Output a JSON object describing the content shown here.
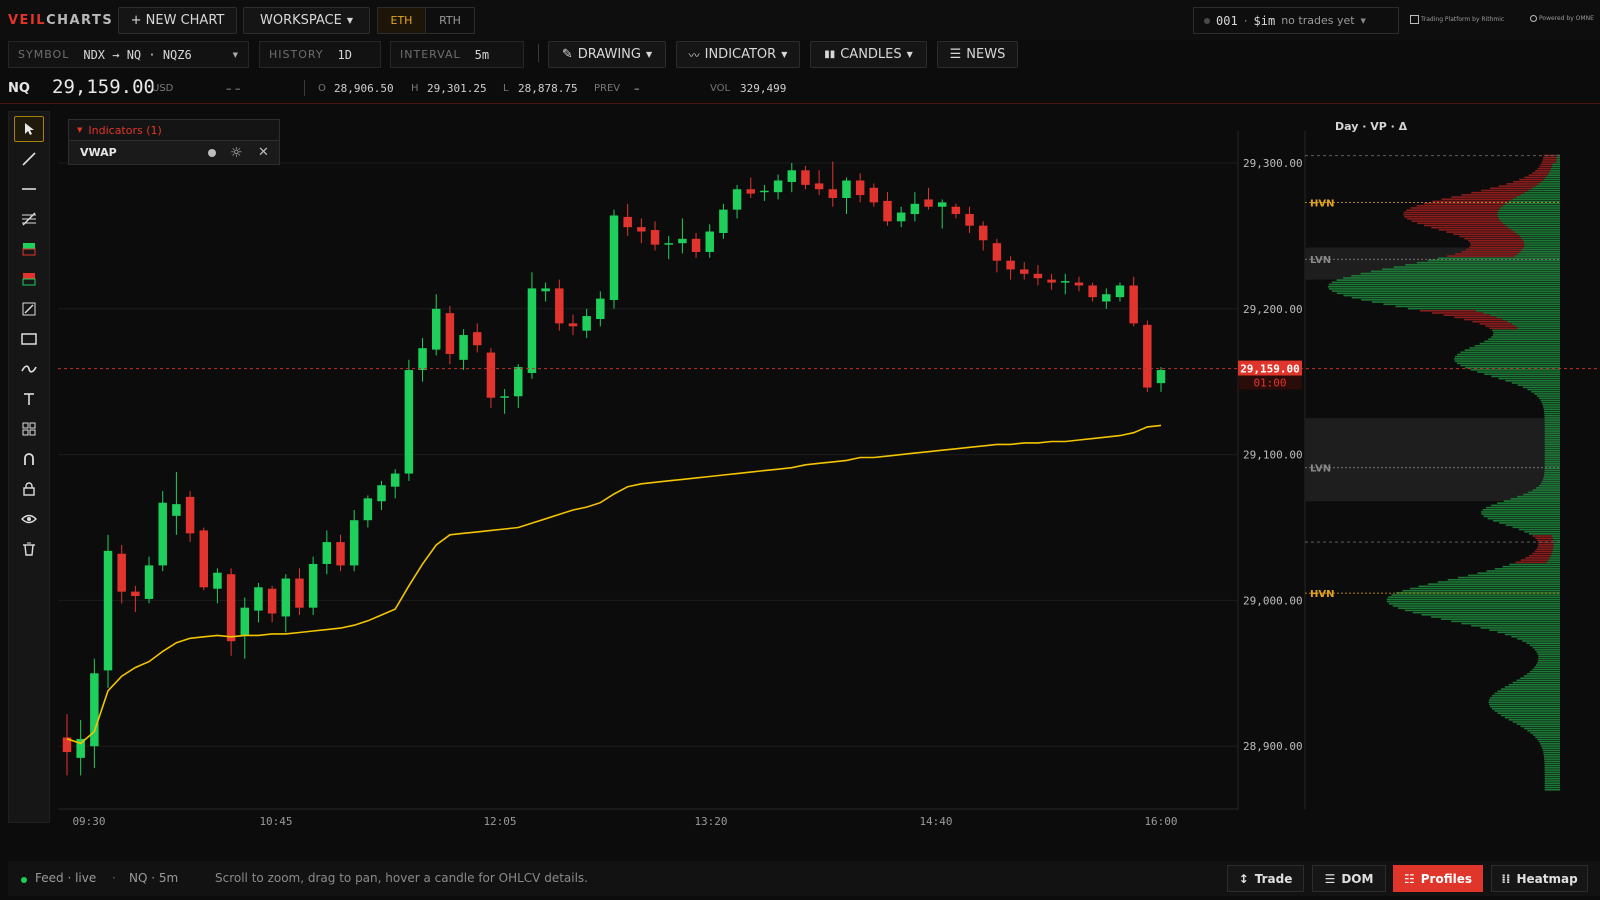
{
  "app": {
    "logo_part1": "VEIL",
    "logo_part2": "CHARTS"
  },
  "topbar": {
    "new_chart": "+ NEW CHART",
    "workspace": "WORKSPACE",
    "session_eth": "ETH",
    "session_rth": "RTH",
    "account_id": "001",
    "account_type": "$im",
    "account_status": "no trades yet",
    "brand_rithmic": "Trading Platform by Rithmic",
    "brand_omne": "Powered by OMNE"
  },
  "toolbar": {
    "symbol_label": "SYMBOL",
    "symbol_value": "NDX → NQ · NQZ6",
    "history_label": "HISTORY",
    "history_value": "1D",
    "interval_label": "INTERVAL",
    "interval_value": "5m",
    "drawing": "DRAWING",
    "indicator": "INDICATOR",
    "candles": "CANDLES",
    "news": "NEWS"
  },
  "quote": {
    "symbol": "NQ",
    "price": "29,159.00",
    "currency": "USD",
    "change": "– –",
    "open_label": "O",
    "open": "28,906.50",
    "high_label": "H",
    "high": "29,301.25",
    "low_label": "L",
    "low": "28,878.75",
    "prev_label": "PREV",
    "prev": "–",
    "vol_label": "VOL",
    "vol": "329,499"
  },
  "indicators_panel": {
    "header": "Indicators (1)",
    "items": [
      {
        "label": "VWAP"
      }
    ]
  },
  "volume_profile": {
    "title": "Day · VP · Δ",
    "hvn_label": "HVN",
    "lvn_label": "LVN"
  },
  "price_axis": {
    "ticks": [
      {
        "label": "29,300.00",
        "value": 29300
      },
      {
        "label": "29,200.00",
        "value": 29200
      },
      {
        "label": "29,100.00",
        "value": 29100
      },
      {
        "label": "29,000.00",
        "value": 29000
      },
      {
        "label": "28,900.00",
        "value": 28900
      }
    ],
    "current_price_label": "29,159.00",
    "countdown": "01:00"
  },
  "time_axis": {
    "ticks": [
      "09:30",
      "10:45",
      "12:05",
      "13:20",
      "14:40",
      "16:00"
    ]
  },
  "colors": {
    "up": "#1fcf5c",
    "down": "#e2342e",
    "vwap": "#f3c400",
    "accent": "#e0352b",
    "gold": "#e4a41d",
    "vp_up": "#1c7a37",
    "vp_down": "#8c1d1d"
  },
  "chart_data": {
    "type": "candlestick",
    "ylim": [
      28850,
      29330
    ],
    "candles": [
      {
        "o": 28906,
        "h": 28922,
        "l": 28880,
        "c": 28896
      },
      {
        "o": 28892,
        "h": 28918,
        "l": 28880,
        "c": 28905
      },
      {
        "o": 28900,
        "h": 28960,
        "l": 28885,
        "c": 28950
      },
      {
        "o": 28952,
        "h": 29045,
        "l": 28940,
        "c": 29034
      },
      {
        "o": 29032,
        "h": 29038,
        "l": 28998,
        "c": 29006
      },
      {
        "o": 29006,
        "h": 29010,
        "l": 28992,
        "c": 29003
      },
      {
        "o": 29001,
        "h": 29030,
        "l": 28998,
        "c": 29024
      },
      {
        "o": 29024,
        "h": 29075,
        "l": 29020,
        "c": 29067
      },
      {
        "o": 29058,
        "h": 29088,
        "l": 29045,
        "c": 29066
      },
      {
        "o": 29071,
        "h": 29075,
        "l": 29040,
        "c": 29046
      },
      {
        "o": 29048,
        "h": 29050,
        "l": 29007,
        "c": 29009
      },
      {
        "o": 29008,
        "h": 29022,
        "l": 28998,
        "c": 29019
      },
      {
        "o": 29018,
        "h": 29022,
        "l": 28962,
        "c": 28972
      },
      {
        "o": 28976,
        "h": 29002,
        "l": 28960,
        "c": 28995
      },
      {
        "o": 28993,
        "h": 29012,
        "l": 28985,
        "c": 29009
      },
      {
        "o": 29008,
        "h": 29010,
        "l": 28985,
        "c": 28991
      },
      {
        "o": 28989,
        "h": 29018,
        "l": 28978,
        "c": 29015
      },
      {
        "o": 29015,
        "h": 29022,
        "l": 28990,
        "c": 28995
      },
      {
        "o": 28995,
        "h": 29030,
        "l": 28990,
        "c": 29025
      },
      {
        "o": 29025,
        "h": 29048,
        "l": 29018,
        "c": 29040
      },
      {
        "o": 29040,
        "h": 29045,
        "l": 29020,
        "c": 29024
      },
      {
        "o": 29024,
        "h": 29062,
        "l": 29020,
        "c": 29055
      },
      {
        "o": 29055,
        "h": 29072,
        "l": 29050,
        "c": 29070
      },
      {
        "o": 29068,
        "h": 29082,
        "l": 29062,
        "c": 29079
      },
      {
        "o": 29078,
        "h": 29090,
        "l": 29070,
        "c": 29087
      },
      {
        "o": 29087,
        "h": 29165,
        "l": 29082,
        "c": 29158
      },
      {
        "o": 29158,
        "h": 29180,
        "l": 29150,
        "c": 29173
      },
      {
        "o": 29172,
        "h": 29210,
        "l": 29168,
        "c": 29200
      },
      {
        "o": 29197,
        "h": 29202,
        "l": 29162,
        "c": 29169
      },
      {
        "o": 29165,
        "h": 29186,
        "l": 29158,
        "c": 29182
      },
      {
        "o": 29184,
        "h": 29190,
        "l": 29170,
        "c": 29175
      },
      {
        "o": 29170,
        "h": 29173,
        "l": 29132,
        "c": 29139
      },
      {
        "o": 29139,
        "h": 29145,
        "l": 29128,
        "c": 29140
      },
      {
        "o": 29140,
        "h": 29162,
        "l": 29132,
        "c": 29160
      },
      {
        "o": 29156,
        "h": 29225,
        "l": 29152,
        "c": 29214
      },
      {
        "o": 29212,
        "h": 29218,
        "l": 29205,
        "c": 29214
      },
      {
        "o": 29214,
        "h": 29220,
        "l": 29185,
        "c": 29190
      },
      {
        "o": 29190,
        "h": 29196,
        "l": 29182,
        "c": 29188
      },
      {
        "o": 29185,
        "h": 29200,
        "l": 29180,
        "c": 29195
      },
      {
        "o": 29193,
        "h": 29212,
        "l": 29188,
        "c": 29207
      },
      {
        "o": 29206,
        "h": 29268,
        "l": 29200,
        "c": 29264
      },
      {
        "o": 29263,
        "h": 29272,
        "l": 29250,
        "c": 29256
      },
      {
        "o": 29256,
        "h": 29262,
        "l": 29245,
        "c": 29253
      },
      {
        "o": 29254,
        "h": 29260,
        "l": 29240,
        "c": 29244
      },
      {
        "o": 29244,
        "h": 29250,
        "l": 29234,
        "c": 29245
      },
      {
        "o": 29245,
        "h": 29262,
        "l": 29238,
        "c": 29248
      },
      {
        "o": 29248,
        "h": 29252,
        "l": 29235,
        "c": 29239
      },
      {
        "o": 29239,
        "h": 29258,
        "l": 29235,
        "c": 29253
      },
      {
        "o": 29252,
        "h": 29272,
        "l": 29248,
        "c": 29268
      },
      {
        "o": 29268,
        "h": 29285,
        "l": 29262,
        "c": 29282
      },
      {
        "o": 29282,
        "h": 29290,
        "l": 29276,
        "c": 29279
      },
      {
        "o": 29280,
        "h": 29285,
        "l": 29274,
        "c": 29281
      },
      {
        "o": 29280,
        "h": 29292,
        "l": 29275,
        "c": 29288
      },
      {
        "o": 29287,
        "h": 29300,
        "l": 29280,
        "c": 29295
      },
      {
        "o": 29295,
        "h": 29298,
        "l": 29282,
        "c": 29285
      },
      {
        "o": 29286,
        "h": 29295,
        "l": 29278,
        "c": 29282
      },
      {
        "o": 29282,
        "h": 29301,
        "l": 29270,
        "c": 29276
      },
      {
        "o": 29276,
        "h": 29290,
        "l": 29265,
        "c": 29288
      },
      {
        "o": 29288,
        "h": 29293,
        "l": 29273,
        "c": 29278
      },
      {
        "o": 29283,
        "h": 29286,
        "l": 29270,
        "c": 29273
      },
      {
        "o": 29274,
        "h": 29280,
        "l": 29257,
        "c": 29260
      },
      {
        "o": 29260,
        "h": 29270,
        "l": 29256,
        "c": 29266
      },
      {
        "o": 29265,
        "h": 29280,
        "l": 29260,
        "c": 29272
      },
      {
        "o": 29275,
        "h": 29283,
        "l": 29268,
        "c": 29270
      },
      {
        "o": 29270,
        "h": 29275,
        "l": 29255,
        "c": 29273
      },
      {
        "o": 29270,
        "h": 29272,
        "l": 29262,
        "c": 29265
      },
      {
        "o": 29265,
        "h": 29270,
        "l": 29252,
        "c": 29257
      },
      {
        "o": 29257,
        "h": 29260,
        "l": 29240,
        "c": 29247
      },
      {
        "o": 29245,
        "h": 29248,
        "l": 29225,
        "c": 29233
      },
      {
        "o": 29233,
        "h": 29236,
        "l": 29220,
        "c": 29227
      },
      {
        "o": 29227,
        "h": 29232,
        "l": 29220,
        "c": 29224
      },
      {
        "o": 29224,
        "h": 29230,
        "l": 29216,
        "c": 29221
      },
      {
        "o": 29220,
        "h": 29224,
        "l": 29213,
        "c": 29218
      },
      {
        "o": 29218,
        "h": 29224,
        "l": 29210,
        "c": 29219
      },
      {
        "o": 29218,
        "h": 29222,
        "l": 29212,
        "c": 29216
      },
      {
        "o": 29216,
        "h": 29218,
        "l": 29205,
        "c": 29208
      },
      {
        "o": 29205,
        "h": 29214,
        "l": 29200,
        "c": 29210
      },
      {
        "o": 29208,
        "h": 29218,
        "l": 29205,
        "c": 29216
      },
      {
        "o": 29216,
        "h": 29222,
        "l": 29188,
        "c": 29190
      },
      {
        "o": 29189,
        "h": 29192,
        "l": 29143,
        "c": 29146
      },
      {
        "o": 29149,
        "h": 29160,
        "l": 29143,
        "c": 29158
      }
    ],
    "vwap": [
      28905,
      28902,
      28910,
      28938,
      28948,
      28954,
      28958,
      28965,
      28971,
      28974,
      28975,
      28976,
      28975,
      28976,
      28976,
      28977,
      28977,
      28978,
      28979,
      28980,
      28981,
      28983,
      28986,
      28990,
      28994,
      29010,
      29025,
      29038,
      29045,
      29046,
      29047,
      29048,
      29049,
      29050,
      29053,
      29056,
      29059,
      29062,
      29064,
      29067,
      29073,
      29078,
      29080,
      29081,
      29082,
      29083,
      29084,
      29085,
      29086,
      29087,
      29088,
      29089,
      29090,
      29091,
      29093,
      29094,
      29095,
      29096,
      29098,
      29098,
      29099,
      29100,
      29101,
      29102,
      29103,
      29104,
      29105,
      29106,
      29107,
      29107,
      29108,
      29108,
      29109,
      29109,
      29110,
      29111,
      29112,
      29113,
      29115,
      29119,
      29120
    ]
  }
}
